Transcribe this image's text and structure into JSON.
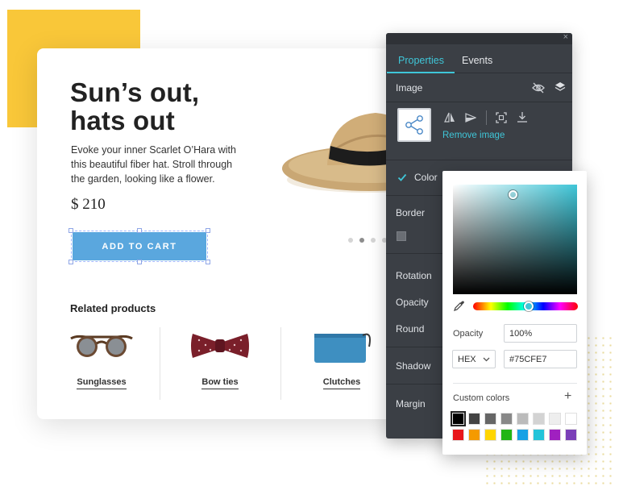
{
  "hero": {
    "headline_line1": "Sun’s out,",
    "headline_line2": "hats out",
    "description": "Evoke your inner Scarlet O’Hara with this beautiful fiber hat. Stroll through the garden, looking like a flower.",
    "price": "$ 210",
    "cta_label": "ADD TO CART"
  },
  "related": {
    "title": "Related products",
    "products": [
      {
        "name": "Sunglasses",
        "icon": "sunglasses-icon"
      },
      {
        "name": "Bow ties",
        "icon": "bow-tie-icon"
      },
      {
        "name": "Clutches",
        "icon": "clutch-icon"
      }
    ]
  },
  "panel": {
    "close_glyph": "×",
    "tabs": [
      {
        "label": "Properties",
        "active": true
      },
      {
        "label": "Events",
        "active": false
      }
    ],
    "element_type": "Image",
    "remove_image": "Remove image",
    "labels": {
      "color": "Color",
      "border": "Border",
      "rotation": "Rotation",
      "opacity": "Opacity",
      "round": "Round",
      "shadow": "Shadow",
      "margin": "Margin"
    },
    "color_enabled": true,
    "accent": "#3fc6d8"
  },
  "color_picker": {
    "opacity_label": "Opacity",
    "opacity_value": "100%",
    "format": "HEX",
    "hex_value": "#75CFE7",
    "custom_colors_label": "Custom colors",
    "add_glyph": "+",
    "swatches": [
      "#000000",
      "#444444",
      "#666666",
      "#888888",
      "#bbbbbb",
      "#d3d3d3",
      "#eeeeee",
      "#ffffff",
      "#e8161b",
      "#f59a00",
      "#ffd500",
      "#22b514",
      "#17a1e5",
      "#23c4d9",
      "#a020c0",
      "#7b3fb8"
    ]
  }
}
